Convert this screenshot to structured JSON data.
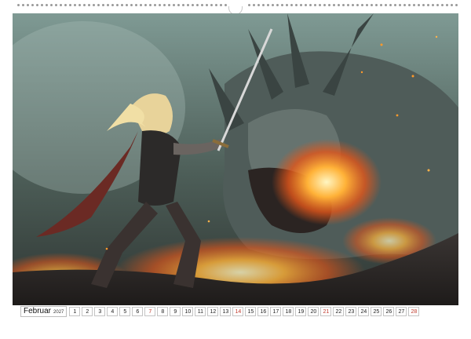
{
  "calendar": {
    "month": "Februar",
    "year": "2027",
    "days": [
      {
        "n": "1",
        "sun": false
      },
      {
        "n": "2",
        "sun": false
      },
      {
        "n": "3",
        "sun": false
      },
      {
        "n": "4",
        "sun": false
      },
      {
        "n": "5",
        "sun": false
      },
      {
        "n": "6",
        "sun": false
      },
      {
        "n": "7",
        "sun": true
      },
      {
        "n": "8",
        "sun": false
      },
      {
        "n": "9",
        "sun": false
      },
      {
        "n": "10",
        "sun": false
      },
      {
        "n": "11",
        "sun": false
      },
      {
        "n": "12",
        "sun": false
      },
      {
        "n": "13",
        "sun": false
      },
      {
        "n": "14",
        "sun": true
      },
      {
        "n": "15",
        "sun": false
      },
      {
        "n": "16",
        "sun": false
      },
      {
        "n": "17",
        "sun": false
      },
      {
        "n": "18",
        "sun": false
      },
      {
        "n": "19",
        "sun": false
      },
      {
        "n": "20",
        "sun": false
      },
      {
        "n": "21",
        "sun": true
      },
      {
        "n": "22",
        "sun": false
      },
      {
        "n": "23",
        "sun": false
      },
      {
        "n": "24",
        "sun": false
      },
      {
        "n": "25",
        "sun": false
      },
      {
        "n": "26",
        "sun": false
      },
      {
        "n": "27",
        "sun": false
      },
      {
        "n": "28",
        "sun": true
      }
    ]
  },
  "colors": {
    "sunday": "#c0392b",
    "fire": "#ff8a1e",
    "dragon": "#5b6a66"
  }
}
